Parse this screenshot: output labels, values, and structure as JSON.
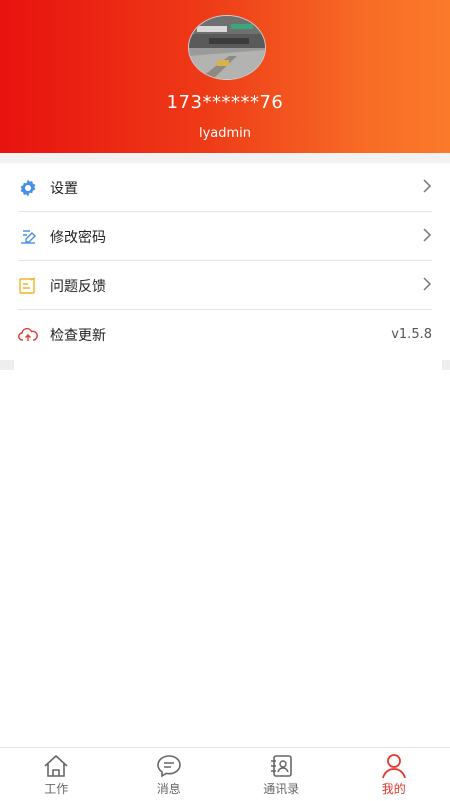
{
  "profile": {
    "phone": "173******76",
    "username": "lyadmin"
  },
  "menu": {
    "items": [
      {
        "label": "设置",
        "icon": "gear-icon",
        "icon_color": "#4a90e2"
      },
      {
        "label": "修改密码",
        "icon": "edit-password-icon",
        "icon_color": "#4a90e2"
      },
      {
        "label": "问题反馈",
        "icon": "feedback-icon",
        "icon_color": "#f5b323"
      },
      {
        "label": "检查更新",
        "icon": "cloud-upload-icon",
        "icon_color": "#e8352a",
        "value": "v1.5.8"
      }
    ]
  },
  "tabbar": {
    "tabs": [
      {
        "label": "工作",
        "icon": "home-icon"
      },
      {
        "label": "消息",
        "icon": "message-icon"
      },
      {
        "label": "通讯录",
        "icon": "contacts-icon"
      },
      {
        "label": "我的",
        "icon": "user-icon",
        "active": true
      }
    ]
  },
  "colors": {
    "header_gradient_start": "#e8120f",
    "header_gradient_end": "#fb7a2a",
    "accent": "#e8352a"
  }
}
